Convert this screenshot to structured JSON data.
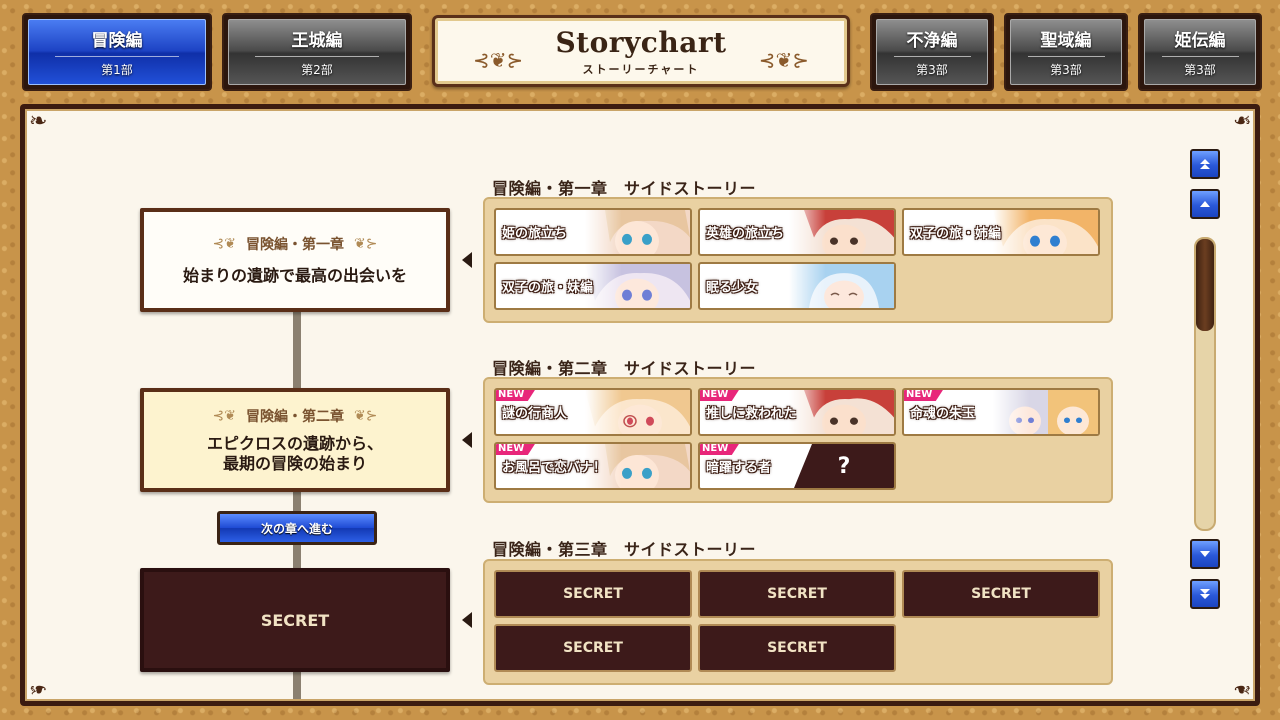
{
  "tabs": [
    {
      "title": "冒険編",
      "sub": "第1部",
      "active": true
    },
    {
      "title": "王城編",
      "sub": "第2部"
    },
    {
      "title": "不浄編",
      "sub": "第3部"
    },
    {
      "title": "聖域編",
      "sub": "第3部"
    },
    {
      "title": "姫伝編",
      "sub": "第3部"
    }
  ],
  "header": {
    "title": "Storychart",
    "subtitle": "ストーリーチャート"
  },
  "chapters": [
    {
      "head": "冒険編・第一章",
      "title": "始まりの遺跡で最高の出会いを"
    },
    {
      "head": "冒険編・第二章",
      "title": "エピクロスの遺跡から、\n最期の冒険の始まり"
    },
    {
      "title": "SECRET"
    }
  ],
  "next_button": "次の章へ進む",
  "sections": [
    {
      "title": "冒険編・第一章　サイドストーリー",
      "stories": [
        "姫の旅立ち",
        "英雄の旅立ち",
        "双子の旅・姉編",
        "双子の旅・妹編",
        "眠る少女"
      ]
    },
    {
      "title": "冒険編・第二章　サイドストーリー",
      "stories": [
        "謎の行商人",
        "推しに救われた",
        "命魂の朱玉",
        "お風呂で恋バナ！",
        "暗躍する者"
      ],
      "new_label": "NEW",
      "mystery": "?"
    },
    {
      "title": "冒険編・第三章　サイドストーリー",
      "stories": [
        "SECRET",
        "SECRET",
        "SECRET",
        "SECRET",
        "SECRET"
      ]
    }
  ],
  "icons": {
    "scroll_top": "double-up-arrow-icon",
    "scroll_up": "up-arrow-icon",
    "scroll_down": "down-arrow-icon",
    "scroll_bottom": "double-down-arrow-icon"
  },
  "colors": {
    "accent_blue": "#1d43c4",
    "panel_dark": "#3b1b10",
    "new_badge": "#e8267a",
    "secret_bg": "#3d1a1a"
  }
}
